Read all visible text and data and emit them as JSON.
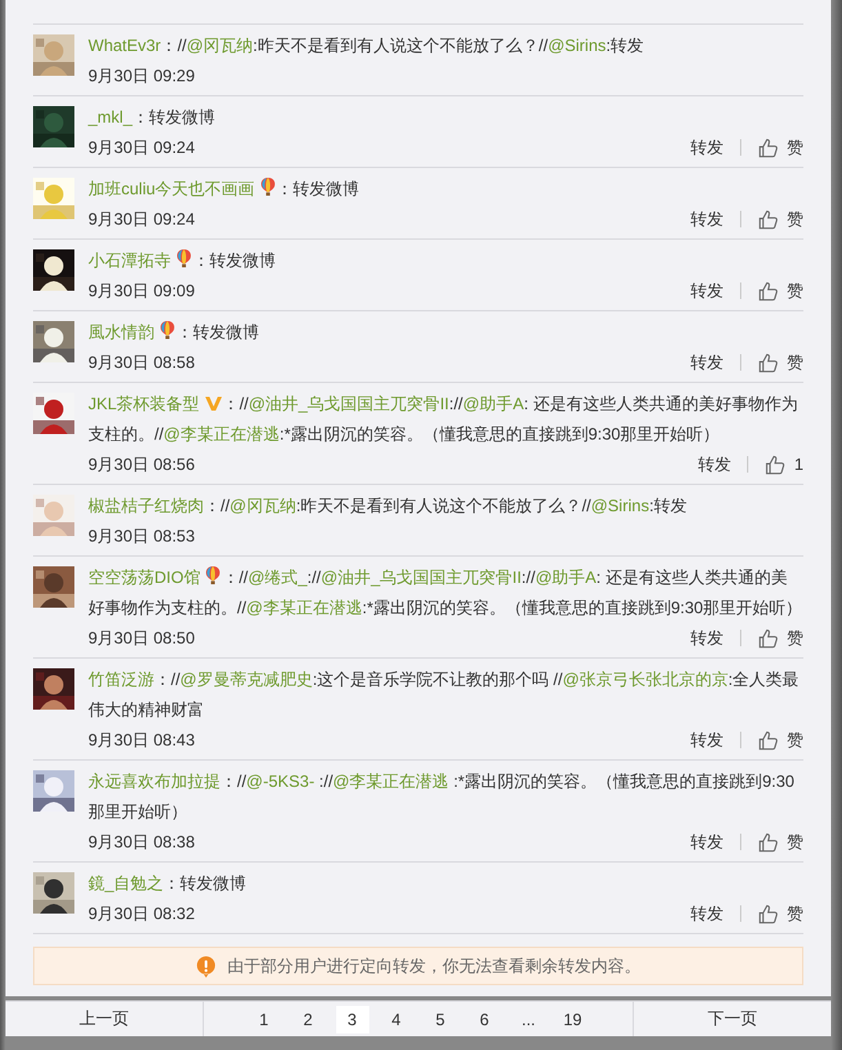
{
  "comments": [
    {
      "user": "WhatEv3r",
      "kind": "plain",
      "content": [
        {
          "kind": "text",
          "text": "：//"
        },
        {
          "kind": "mention",
          "text": "@冈瓦纳"
        },
        {
          "kind": "text",
          "text": ":昨天不是看到有人说这个不能放了么？//"
        },
        {
          "kind": "mention",
          "text": "@Sirins"
        },
        {
          "kind": "text",
          "text": ":转发"
        }
      ],
      "time": "9月30日 09:29"
    },
    {
      "user": "_mkl_",
      "kind": "plain",
      "content": [
        {
          "kind": "text",
          "text": "：转发微博"
        }
      ],
      "time": "9月30日 09:24",
      "repost": "转发",
      "like": "赞"
    },
    {
      "user": "加班culiu今天也不画画",
      "kind": "balloon",
      "content": [
        {
          "kind": "text",
          "text": "：转发微博"
        }
      ],
      "time": "9月30日 09:24",
      "repost": "转发",
      "like": "赞"
    },
    {
      "user": "小石潭拓寺",
      "kind": "balloon",
      "content": [
        {
          "kind": "text",
          "text": "：转发微博"
        }
      ],
      "time": "9月30日 09:09",
      "repost": "转发",
      "like": "赞"
    },
    {
      "user": "風水情韵",
      "kind": "balloon",
      "content": [
        {
          "kind": "text",
          "text": "：转发微博"
        }
      ],
      "time": "9月30日 08:58",
      "repost": "转发",
      "like": "赞"
    },
    {
      "user": "JKL茶杯装备型",
      "kind": "vip",
      "content": [
        {
          "kind": "text",
          "text": "：//"
        },
        {
          "kind": "mention",
          "text": "@油井_乌戈国国主兀突骨II"
        },
        {
          "kind": "text",
          "text": "://"
        },
        {
          "kind": "mention",
          "text": "@助手A"
        },
        {
          "kind": "text",
          "text": ": 还是有这些人类共通的美好事物作为支柱的。//"
        },
        {
          "kind": "mention",
          "text": "@李某正在潜逃"
        },
        {
          "kind": "text",
          "text": ":*露出阴沉的笑容。（懂我意思的直接跳到9:30那里开始听）"
        }
      ],
      "time": "9月30日 08:56",
      "repost": "转发",
      "like": "1"
    },
    {
      "user": "椒盐桔子红烧肉",
      "kind": "plain",
      "content": [
        {
          "kind": "text",
          "text": "：//"
        },
        {
          "kind": "mention",
          "text": "@冈瓦纳"
        },
        {
          "kind": "text",
          "text": ":昨天不是看到有人说这个不能放了么？//"
        },
        {
          "kind": "mention",
          "text": "@Sirins"
        },
        {
          "kind": "text",
          "text": ":转发"
        }
      ],
      "time": "9月30日 08:53"
    },
    {
      "user": "空空荡荡DIO馆",
      "kind": "balloon",
      "content": [
        {
          "kind": "text",
          "text": "：//"
        },
        {
          "kind": "mention",
          "text": "@绻式_"
        },
        {
          "kind": "text",
          "text": "://"
        },
        {
          "kind": "mention",
          "text": "@油井_乌戈国国主兀突骨II"
        },
        {
          "kind": "text",
          "text": "://"
        },
        {
          "kind": "mention",
          "text": "@助手A"
        },
        {
          "kind": "text",
          "text": ": 还是有这些人类共通的美好事物作为支柱的。//"
        },
        {
          "kind": "mention",
          "text": "@李某正在潜逃"
        },
        {
          "kind": "text",
          "text": ":*露出阴沉的笑容。（懂我意思的直接跳到9:30那里开始听）"
        }
      ],
      "time": "9月30日 08:50",
      "repost": "转发",
      "like": "赞"
    },
    {
      "user": "竹笛泛游",
      "kind": "plain",
      "content": [
        {
          "kind": "text",
          "text": "：//"
        },
        {
          "kind": "mention",
          "text": "@罗曼蒂克减肥史"
        },
        {
          "kind": "text",
          "text": ":这个是音乐学院不让教的那个吗 //"
        },
        {
          "kind": "mention",
          "text": "@张京弓长张北京的京"
        },
        {
          "kind": "text",
          "text": ":全人类最伟大的精神财富"
        }
      ],
      "time": "9月30日 08:43",
      "repost": "转发",
      "like": "赞"
    },
    {
      "user": "永远喜欢布加拉提",
      "kind": "plain",
      "content": [
        {
          "kind": "text",
          "text": "：//"
        },
        {
          "kind": "mention",
          "text": "@-5KS3-"
        },
        {
          "kind": "text",
          "text": " ://"
        },
        {
          "kind": "mention",
          "text": "@李某正在潜逃"
        },
        {
          "kind": "text",
          "text": " :*露出阴沉的笑容。（懂我意思的直接跳到9:30那里开始听）"
        }
      ],
      "time": "9月30日 08:38",
      "repost": "转发",
      "like": "赞"
    },
    {
      "user": "鏡_自勉之",
      "kind": "plain",
      "content": [
        {
          "kind": "text",
          "text": "：转发微博"
        }
      ],
      "time": "9月30日 08:32",
      "repost": "转发",
      "like": "赞"
    }
  ],
  "notice": "由于部分用户进行定向转发，你无法查看剩余转发内容。",
  "pagination": {
    "prev": "上一页",
    "next": "下一页",
    "pages": [
      {
        "label": "1",
        "selected": false
      },
      {
        "label": "2",
        "selected": false
      },
      {
        "label": "3",
        "selected": true
      },
      {
        "label": "4",
        "selected": false
      },
      {
        "label": "5",
        "selected": false
      },
      {
        "label": "6",
        "selected": false
      },
      {
        "label": "...",
        "selected": false
      },
      {
        "label": "19",
        "selected": false
      }
    ]
  }
}
